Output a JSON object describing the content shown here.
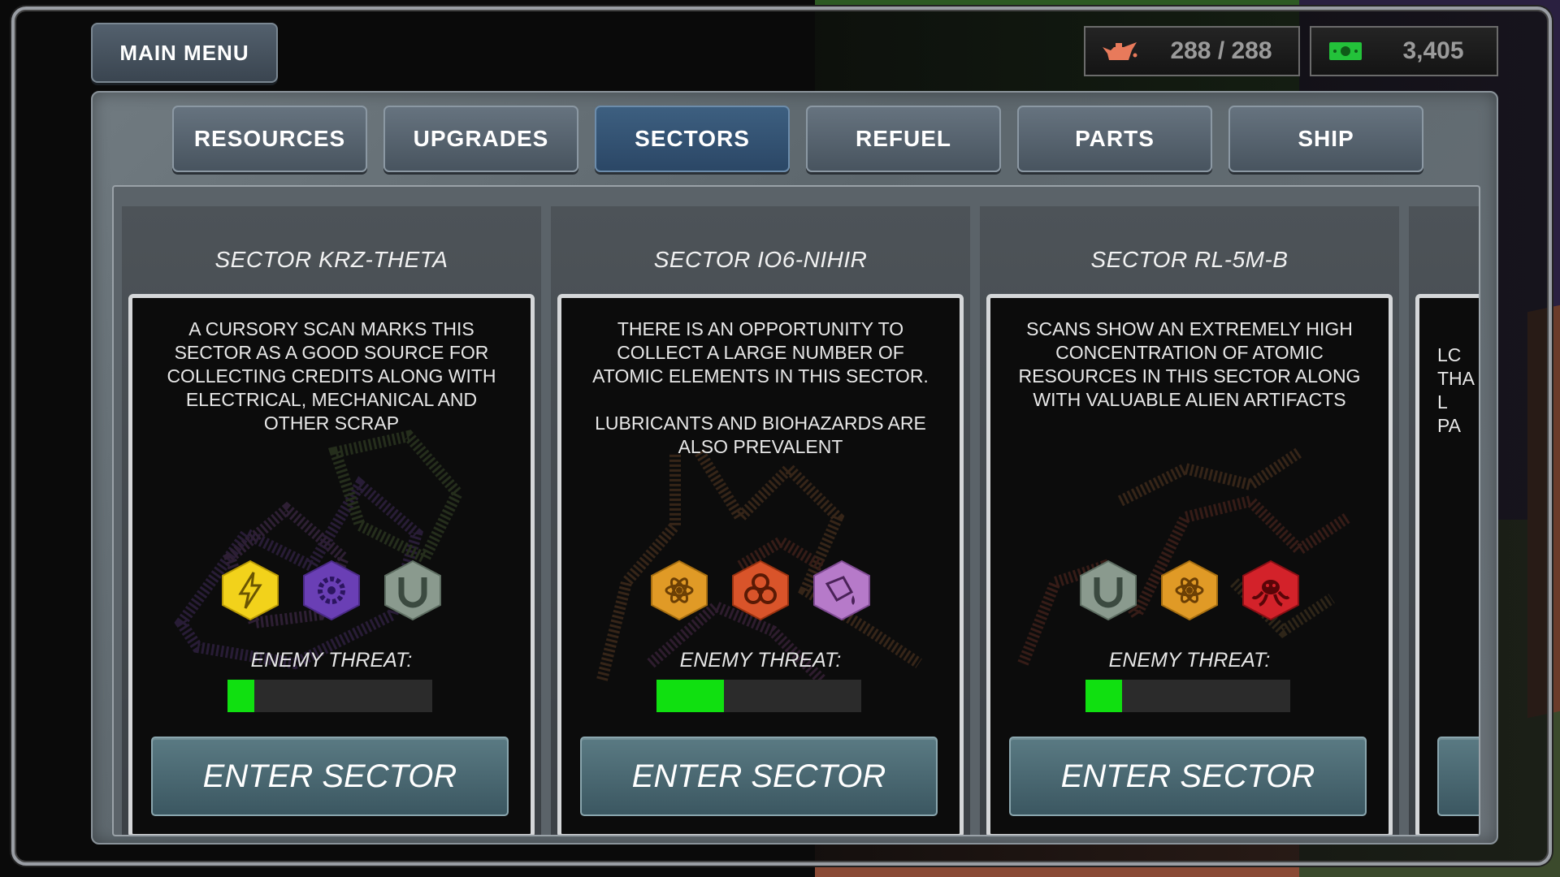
{
  "top_bar": {
    "main_menu_label": "MAIN MENU",
    "fuel": {
      "icon": "oil-can-icon",
      "value": "288 / 288",
      "color": "#e87a5b"
    },
    "credits": {
      "icon": "cash-icon",
      "value": "3,405",
      "color": "#23c23a"
    }
  },
  "tabs": [
    {
      "label": "RESOURCES",
      "active": false
    },
    {
      "label": "UPGRADES",
      "active": false
    },
    {
      "label": "SECTORS",
      "active": true
    },
    {
      "label": "REFUEL",
      "active": false
    },
    {
      "label": "PARTS",
      "active": false
    },
    {
      "label": "SHIP",
      "active": false
    }
  ],
  "sectors": [
    {
      "title": "SECTOR KRZ-THETA",
      "description": "A CURSORY SCAN MARKS THIS\nSECTOR AS A GOOD SOURCE FOR\nCOLLECTING CREDITS ALONG WITH\nELECTRICAL, MECHANICAL AND\nOTHER SCRAP",
      "resource_icons": [
        {
          "name": "lightning-icon",
          "color": "#f2d21b"
        },
        {
          "name": "gear-icon",
          "color": "#6a3fb5"
        },
        {
          "name": "magnet-icon",
          "color": "#8a9a8e"
        }
      ],
      "threat_label": "ENEMY THREAT:",
      "threat_level": 0.13,
      "enter_label": "ENTER SECTOR"
    },
    {
      "title": "SECTOR IO6-NIHIR",
      "description": "THERE IS AN OPPORTUNITY TO\nCOLLECT A LARGE NUMBER OF\nATOMIC ELEMENTS IN THIS SECTOR.\n\nLUBRICANTS AND BIOHAZARDS ARE\nALSO PREVALENT",
      "resource_icons": [
        {
          "name": "atom-icon",
          "color": "#e09a26"
        },
        {
          "name": "biohazard-icon",
          "color": "#d9542a"
        },
        {
          "name": "oil-drop-icon",
          "color": "#b67ac9"
        }
      ],
      "threat_label": "ENEMY THREAT:",
      "threat_level": 0.33,
      "enter_label": "ENTER SECTOR"
    },
    {
      "title": "SECTOR RL-5M-B",
      "description": "SCANS SHOW AN EXTREMELY HIGH\nCONCENTRATION OF ATOMIC\nRESOURCES IN THIS SECTOR ALONG\nWITH VALUABLE ALIEN ARTIFACTS",
      "resource_icons": [
        {
          "name": "magnet-icon",
          "color": "#8a9a8e"
        },
        {
          "name": "atom-icon",
          "color": "#e09a26"
        },
        {
          "name": "alien-icon",
          "color": "#d3222a"
        }
      ],
      "threat_label": "ENEMY THREAT:",
      "threat_level": 0.18,
      "enter_label": "ENTER SECTOR"
    }
  ],
  "partial_card": {
    "description": "LC\nTHA\nL\nPA"
  }
}
